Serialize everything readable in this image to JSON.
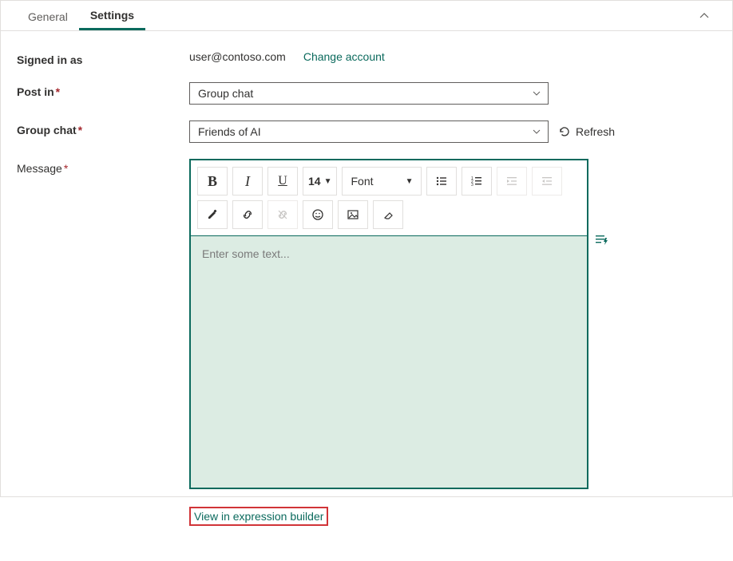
{
  "tabs": {
    "general": "General",
    "settings": "Settings",
    "active": "settings"
  },
  "fields": {
    "signedIn": {
      "label": "Signed in as",
      "email": "user@contoso.com",
      "changeLink": "Change account"
    },
    "postIn": {
      "label": "Post in",
      "value": "Group chat"
    },
    "groupChat": {
      "label": "Group chat",
      "value": "Friends of AI",
      "refresh": "Refresh"
    },
    "message": {
      "label": "Message",
      "placeholder": "Enter some text..."
    }
  },
  "editor": {
    "fontSize": "14",
    "fontFamily": "Font"
  },
  "footer": {
    "exprBuilder": "View in expression builder"
  }
}
